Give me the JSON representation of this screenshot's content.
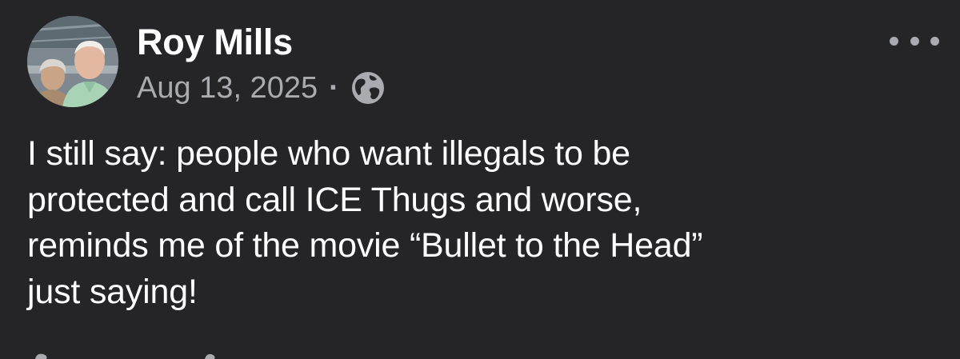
{
  "post": {
    "author": "Roy Mills",
    "date": "Aug 13, 2025",
    "separator": "·",
    "visibility_icon": "globe-icon",
    "more_icon": "more-options-icon",
    "text_lines": [
      "I still say: people who want illegals to be",
      "protected and call ICE Thugs and worse,",
      "reminds me of the movie “Bullet to the Head”",
      "just saying!"
    ]
  },
  "colors": {
    "background": "#252527",
    "primary_text": "#ffffff",
    "secondary_text": "#a9abb0"
  }
}
